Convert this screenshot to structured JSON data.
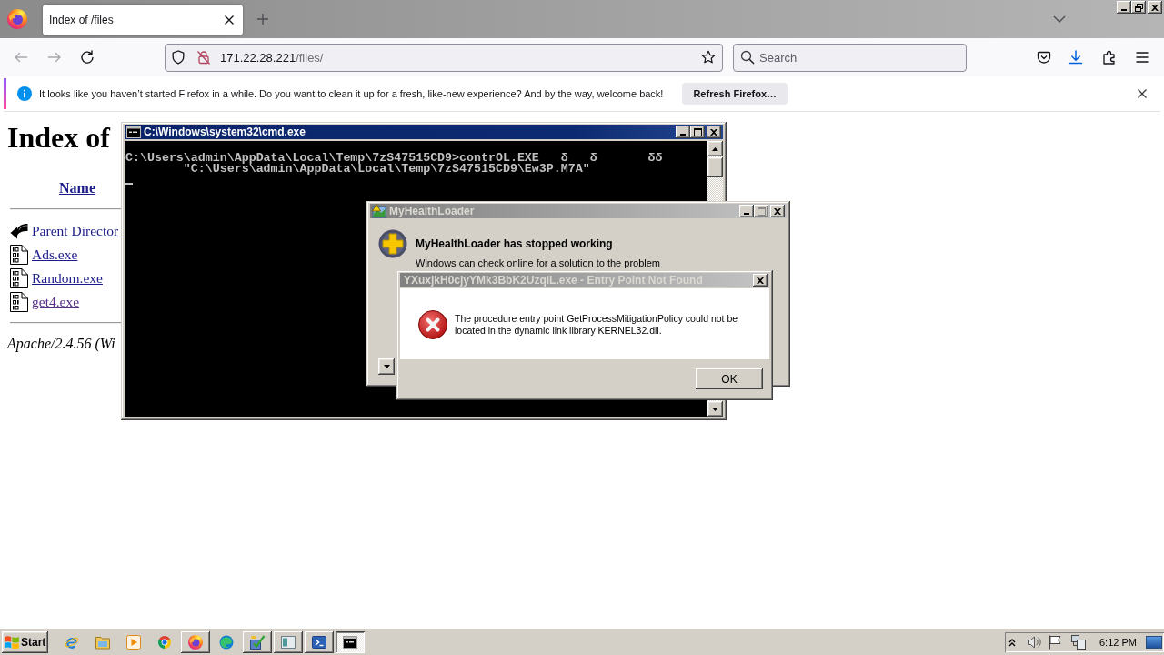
{
  "browser": {
    "tabs": [
      {
        "title": "Index of /files",
        "selected": true
      }
    ],
    "window_buttons": [
      {
        "kind": "minimize",
        "disabled": false
      },
      {
        "kind": "restore",
        "disabled": false
      },
      {
        "kind": "close",
        "disabled": false
      }
    ],
    "navigation": {
      "back": {
        "disabled": true
      },
      "forward": {
        "disabled": true
      }
    },
    "address": {
      "host": "171.22.28.221",
      "path": "/files/"
    },
    "search": {
      "placeholder": "Search"
    },
    "notification": {
      "message": "It looks like you haven’t started Firefox in a while. Do you want to clean it up for a fresh, like-new experience? And by the way, welcome back!",
      "button": "Refresh Firefox…"
    }
  },
  "page": {
    "heading": "Index of",
    "column": "Name",
    "entries": [
      {
        "kind": "parent",
        "name": "Parent Director",
        "visited": false
      },
      {
        "kind": "file",
        "name": "Ads.exe",
        "visited": false
      },
      {
        "kind": "file",
        "name": "Random.exe",
        "visited": false
      },
      {
        "kind": "file",
        "name": "get4.exe",
        "visited": true
      }
    ],
    "footer": "Apache/2.4.56 (Wi"
  },
  "windows": [
    {
      "kind": "console",
      "title": "C:\\Windows\\system32\\cmd.exe",
      "active": true,
      "buttons": [
        {
          "kind": "minimize",
          "disabled": false
        },
        {
          "kind": "maximize",
          "disabled": false
        },
        {
          "kind": "close",
          "disabled": false
        }
      ],
      "lines": [
        "C:\\Users\\admin\\AppData\\Local\\Temp\\7zS47515CD9>contrOL.EXE   δ   δ       δδ",
        "        \"C:\\Users\\admin\\AppData\\Local\\Temp\\7zS47515CD9\\Ew3P.M7A\""
      ]
    },
    {
      "kind": "crash",
      "title": "MyHealthLoader",
      "active": false,
      "buttons": [
        {
          "kind": "minimize",
          "disabled": false
        },
        {
          "kind": "maximize",
          "disabled": true
        },
        {
          "kind": "close",
          "disabled": false
        }
      ],
      "heading": "MyHealthLoader has stopped working",
      "message": "Windows can check online for a solution to the problem"
    },
    {
      "kind": "error",
      "title": "YXuxjkH0cjyYMk3BbK2UzqlL.exe - Entry Point Not Found",
      "active": false,
      "buttons": [
        {
          "kind": "close",
          "disabled": false
        }
      ],
      "message": "The procedure entry point GetProcessMitigationPolicy could not be located in the dynamic link library KERNEL32.dll.",
      "button": "OK"
    }
  ],
  "taskbar": {
    "start": "Start",
    "apps": [
      {
        "kind": "e-browser",
        "running": false,
        "active": false
      },
      {
        "kind": "folder",
        "running": false,
        "active": false
      },
      {
        "kind": "player",
        "running": false,
        "active": false
      },
      {
        "kind": "ring-browser",
        "running": false,
        "active": false
      },
      {
        "kind": "fox-browser",
        "running": true,
        "active": false
      },
      {
        "kind": "wave-browser",
        "running": false,
        "active": false
      },
      {
        "kind": "installer",
        "running": true,
        "active": false
      },
      {
        "kind": "window",
        "running": true,
        "active": false
      },
      {
        "kind": "shell",
        "running": true,
        "active": false
      },
      {
        "kind": "console",
        "running": true,
        "active": true
      }
    ],
    "clock": "6:12 PM"
  }
}
